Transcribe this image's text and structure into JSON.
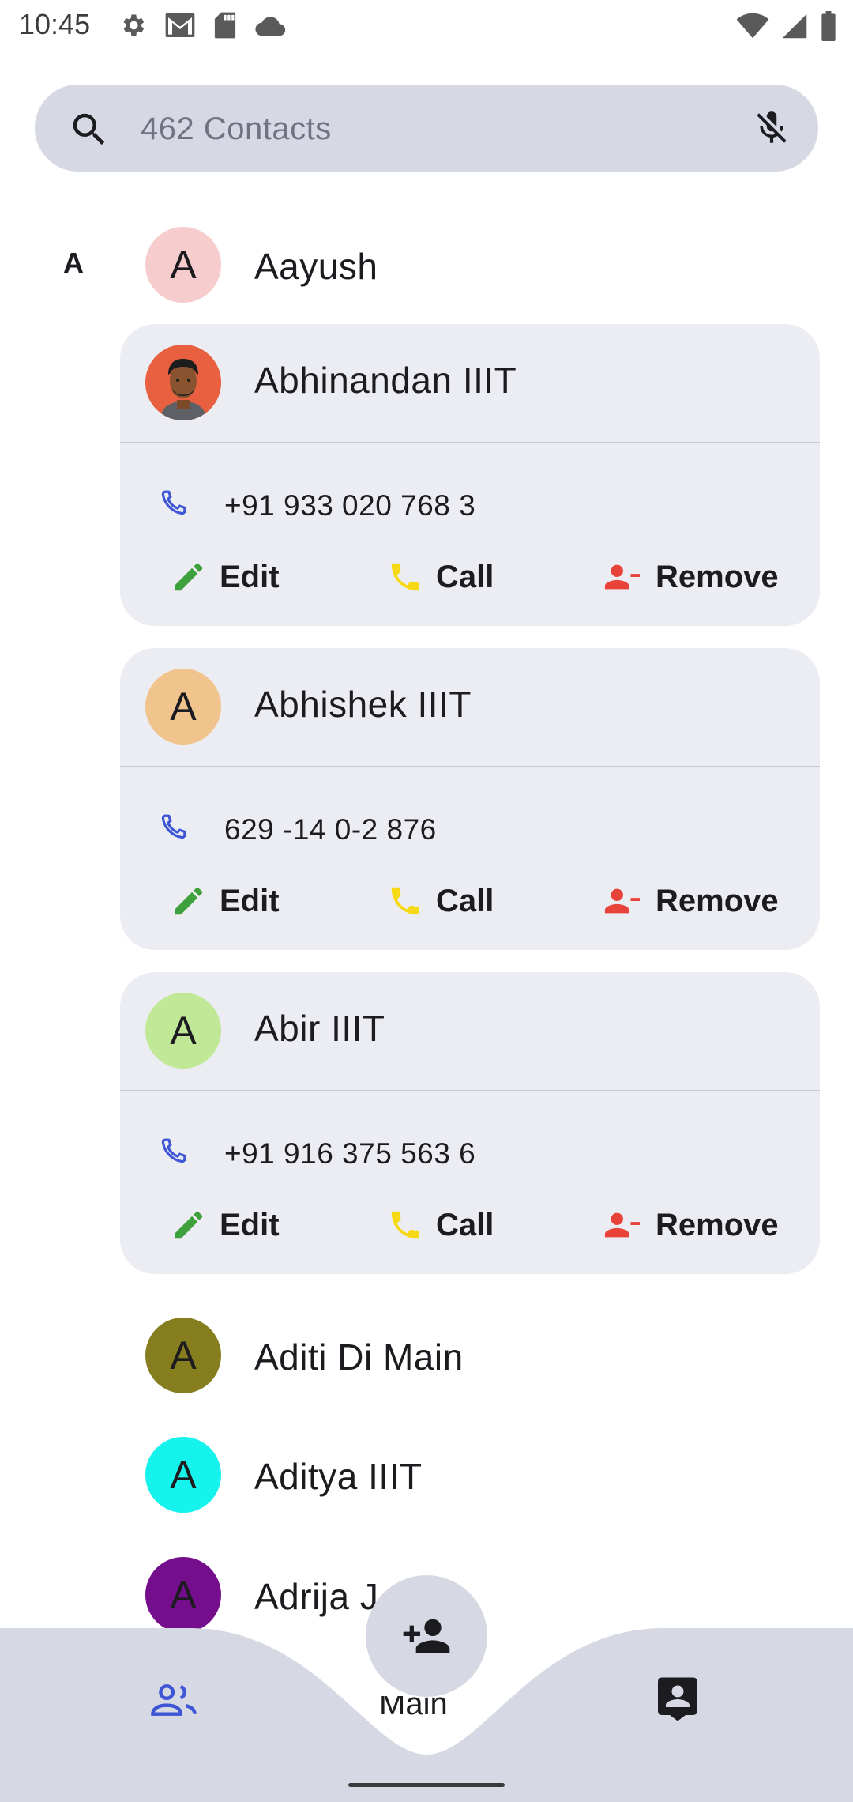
{
  "status_bar": {
    "time": "10:45",
    "left_icons": [
      "gear-icon",
      "gmail-icon",
      "sd-card-icon",
      "cloud-icon"
    ],
    "right_icons": [
      "wifi-icon",
      "cell-signal-icon",
      "battery-icon"
    ]
  },
  "search": {
    "placeholder": "462 Contacts",
    "value": "",
    "icon": "search-icon",
    "mic_icon": "mic-off-icon"
  },
  "section_letter": "A",
  "contacts": [
    {
      "name": "Aayush",
      "initial": "A",
      "avatar_color": "#f7cccc",
      "expanded": false
    },
    {
      "name": "Abhinandan IIIT",
      "initial": "",
      "avatar_color": "#e8603f",
      "avatar_type": "photo",
      "expanded": true,
      "phone": "+91 933 020 768 3"
    },
    {
      "name": "Abhishek IIIT",
      "initial": "A",
      "avatar_color": "#f0c48c",
      "expanded": true,
      "phone": "629 -14 0-2 876"
    },
    {
      "name": "Abir IIIT",
      "initial": "A",
      "avatar_color": "#c0e896",
      "expanded": true,
      "phone": "+91 916 375 563 6"
    },
    {
      "name": "Aditi Di Main",
      "initial": "A",
      "avatar_color": "#857d1e",
      "expanded": false
    },
    {
      "name": "Aditya IIIT",
      "initial": "A",
      "avatar_color": "#16f3ec",
      "expanded": false
    },
    {
      "name": "Adrija J",
      "initial": "A",
      "avatar_color": "#750e8c",
      "expanded": false
    }
  ],
  "card_actions": {
    "edit_label": "Edit",
    "call_label": "Call",
    "remove_label": "Remove",
    "edit_color": "#3fa13e",
    "call_color": "#f6d915",
    "remove_color": "#e8433a",
    "phone_icon_color": "#3e56d6"
  },
  "bottom_nav": {
    "partial_label": "Main",
    "background": "#d6d9e4",
    "active_color": "#3e56d6",
    "fab_icon": "person-add-icon",
    "items": [
      "people-icon",
      "contacts-icon"
    ]
  }
}
